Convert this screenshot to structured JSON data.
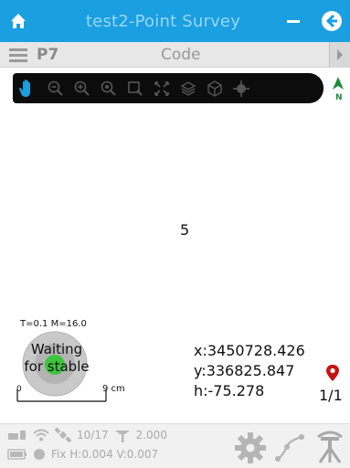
{
  "titlebar": {
    "title": "test2-Point Survey",
    "icons": [
      "home-icon",
      "minimize-icon",
      "back-arrow-icon"
    ]
  },
  "point_row": {
    "point_name": "P7",
    "code_placeholder": "Code"
  },
  "toolbar": {
    "tools": [
      "pan-hand-icon",
      "zoom-out-icon",
      "zoom-in-icon",
      "zoom-reset-icon",
      "zoom-window-icon",
      "zoom-extent-icon",
      "layers-icon",
      "base-map-icon",
      "target-icon",
      "north-arrow-icon"
    ]
  },
  "map": {
    "point_label": "5",
    "tolerance_text": "T=0.1 M=16.0",
    "bubble_text_line1": "Waiting",
    "bubble_text_line2": "for stable",
    "scale_start": "0",
    "scale_end": "9 cm",
    "x_coord": "x:3450728.426",
    "y_coord": "y:336825.847",
    "h_coord": "h:-75.278",
    "page_count": "1/1"
  },
  "status": {
    "satellites": "10/17",
    "antenna_height": "2.000",
    "fix_status": "Fix H:0.004 V:0.007"
  },
  "colors": {
    "titlebar_bg": "#1a9fe0",
    "toolbar_bg": "#0c0c0c",
    "active_tool": "#1a9fe0",
    "bubble_green": "#3cc43c",
    "pin_red": "#c41313",
    "status_text": "#aaaaaa"
  }
}
